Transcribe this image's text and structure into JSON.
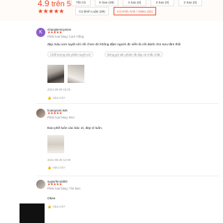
{
  "summary": {
    "score": "4.9",
    "score_suffix": " trên 5",
    "stars": "★★★★★",
    "filters": [
      {
        "label": "Tất Cả"
      },
      {
        "label": "5 Sao (49)"
      },
      {
        "label": "4 Sao (0)"
      },
      {
        "label": "3 Sao (0)"
      },
      {
        "label": "2 Sao (0)"
      },
      {
        "label": "Có Bình Luận (29)"
      },
      {
        "label": "Có Hình Ảnh / Video (22)"
      }
    ]
  },
  "reviews": [
    {
      "avatar_letter": "K",
      "username": "nhangleemcpmee",
      "stars": "★★★★★",
      "variant": "Phân loại hàng: Cam Trắng",
      "comment": "đẹp màu xơn tuyệt vời chỉ chơn đc không đậm người đc viền là chỉ dành cho sưu tầm thôi",
      "tags": [
        "Chất lượng sản phẩm tuyệt vời",
        "Đóng gói sản phẩm rất đẹp và chắc chắn"
      ],
      "date": "2021-06-29 15:20",
      "helpful": "Hữu ích?"
    },
    {
      "username": "hoangnam.946",
      "stars": "★★★★★",
      "variant": "Phân loại hàng: Đen",
      "comment": "Đao phế luôn các bác ơi, đẹp vl luôn.",
      "date": "2021-06-29 12:09",
      "helpful": "Hữu ích?"
    },
    {
      "username": "sugiurfero2803",
      "stars": "★★★★★",
      "variant": "Phân loại hàng: Tím Đen",
      "comment": "Okee",
      "helpful": "Hữu ích?"
    }
  ],
  "icons": {
    "like": "thumbs-up-icon"
  }
}
